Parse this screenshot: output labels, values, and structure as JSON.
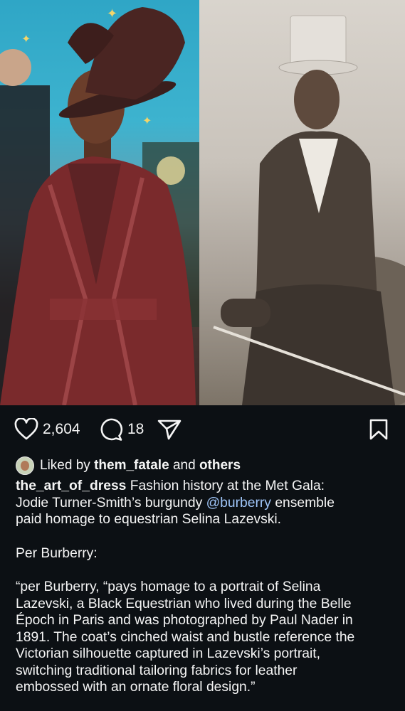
{
  "post": {
    "likes": "2,604",
    "comments": "18",
    "liked_by_prefix": "Liked by",
    "liked_by_user": "them_fatale",
    "liked_by_and": "and",
    "liked_by_others": "others",
    "username": "the_art_of_dress",
    "caption_line1": "Fashion history at the Met Gala:",
    "caption_line2a": "Jodie Turner-Smith’s burgundy",
    "mention": "@burberry",
    "caption_line2b": "ensemble",
    "caption_line3": "paid homage to equestrian Selina Lazevski.",
    "para2": "Per Burberry:",
    "quote": [
      "“per Burberry, “pays homage to a portrait of Selina",
      "Lazevski, a Black Equestrian who lived during the Belle",
      "Époch in Paris and was photographed by Paul Nader in",
      "1891. The coat’s cinched waist and bustle reference the",
      "Victorian silhouette captured in Lazevski’s portrait,",
      "switching traditional tailoring fabrics for leather",
      "embossed with an ornate floral design.”"
    ]
  },
  "icons": {
    "like": "heart-icon",
    "comment": "comment-icon",
    "share": "send-icon",
    "save": "bookmark-icon"
  },
  "colors": {
    "background": "#0c1014",
    "text": "#f5f5f5",
    "mention": "#9fc5f8"
  }
}
